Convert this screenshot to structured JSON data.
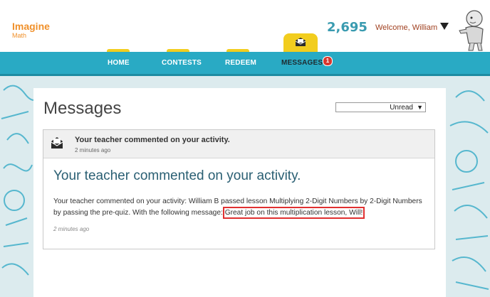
{
  "brand": {
    "name": "Imagine",
    "sub": "Math"
  },
  "header": {
    "points": "2,695",
    "welcome": "Welcome, William"
  },
  "nav": {
    "items": [
      {
        "label": "HOME"
      },
      {
        "label": "CONTESTS"
      },
      {
        "label": "REDEEM"
      },
      {
        "label": "MESSAGES"
      }
    ],
    "badge": "1"
  },
  "page": {
    "title": "Messages",
    "filter": {
      "selected": "Unread"
    }
  },
  "message": {
    "header_title": "Your teacher commented on your activity.",
    "header_time": "2 minutes ago",
    "title": "Your teacher commented on your activity.",
    "body_prefix": "Your teacher commented on your activity: William B passed lesson Multiplying 2-Digit Numbers by 2-Digit Numbers by passing the pre-quiz. With the following message:",
    "body_quote": "Great job on this multiplication lesson, Will!",
    "time": "2 minutes ago"
  },
  "colors": {
    "nav": "#29aac4",
    "tab": "#f2cd1e",
    "brand": "#f0902a",
    "highlight": "#e03030"
  }
}
